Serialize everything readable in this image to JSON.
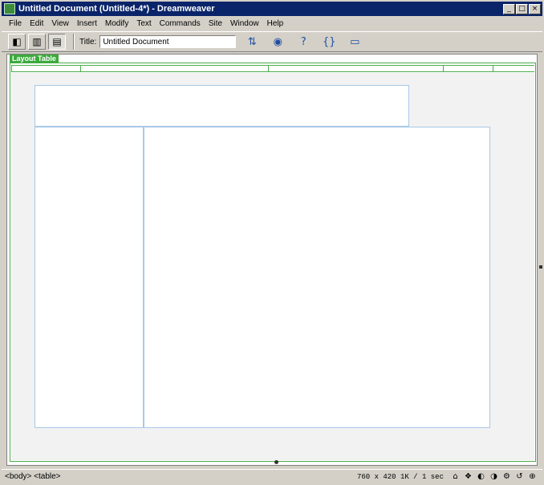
{
  "window": {
    "title": "Untitled Document (Untitled-4*) - Dreamweaver",
    "buttons": {
      "minimize": "_",
      "maximize": "□",
      "close": "×"
    }
  },
  "menubar": {
    "items": [
      "File",
      "Edit",
      "View",
      "Insert",
      "Modify",
      "Text",
      "Commands",
      "Site",
      "Window",
      "Help"
    ]
  },
  "toolbar": {
    "view_buttons": [
      {
        "icon": "code-view-icon",
        "glyph": "◧"
      },
      {
        "icon": "split-view-icon",
        "glyph": "▥"
      },
      {
        "icon": "design-view-icon",
        "glyph": "▤"
      }
    ],
    "title_label": "Title:",
    "title_value": "Untitled Document",
    "tools": [
      {
        "icon": "file-management-icon",
        "glyph": "⇅"
      },
      {
        "icon": "preview-browser-icon",
        "glyph": "◉"
      },
      {
        "icon": "reference-icon",
        "glyph": "?"
      },
      {
        "icon": "code-navigation-icon",
        "glyph": "{}"
      },
      {
        "icon": "view-options-icon",
        "glyph": "▭"
      }
    ]
  },
  "document": {
    "layout_tab": "Layout Table",
    "ruler_marks": [
      "",
      "",
      "",
      "",
      ""
    ]
  },
  "statusbar": {
    "tag_path": "<body> <table>",
    "info": "760 x 420  1K / 1 sec",
    "launchers": [
      {
        "icon": "site-icon",
        "glyph": "⌂"
      },
      {
        "icon": "assets-icon",
        "glyph": "❖"
      },
      {
        "icon": "html-styles-icon",
        "glyph": "◐"
      },
      {
        "icon": "css-styles-icon",
        "glyph": "◑"
      },
      {
        "icon": "behaviors-icon",
        "glyph": "⚙"
      },
      {
        "icon": "history-icon",
        "glyph": "↺"
      },
      {
        "icon": "code-inspector-icon",
        "glyph": "⊕"
      }
    ]
  }
}
